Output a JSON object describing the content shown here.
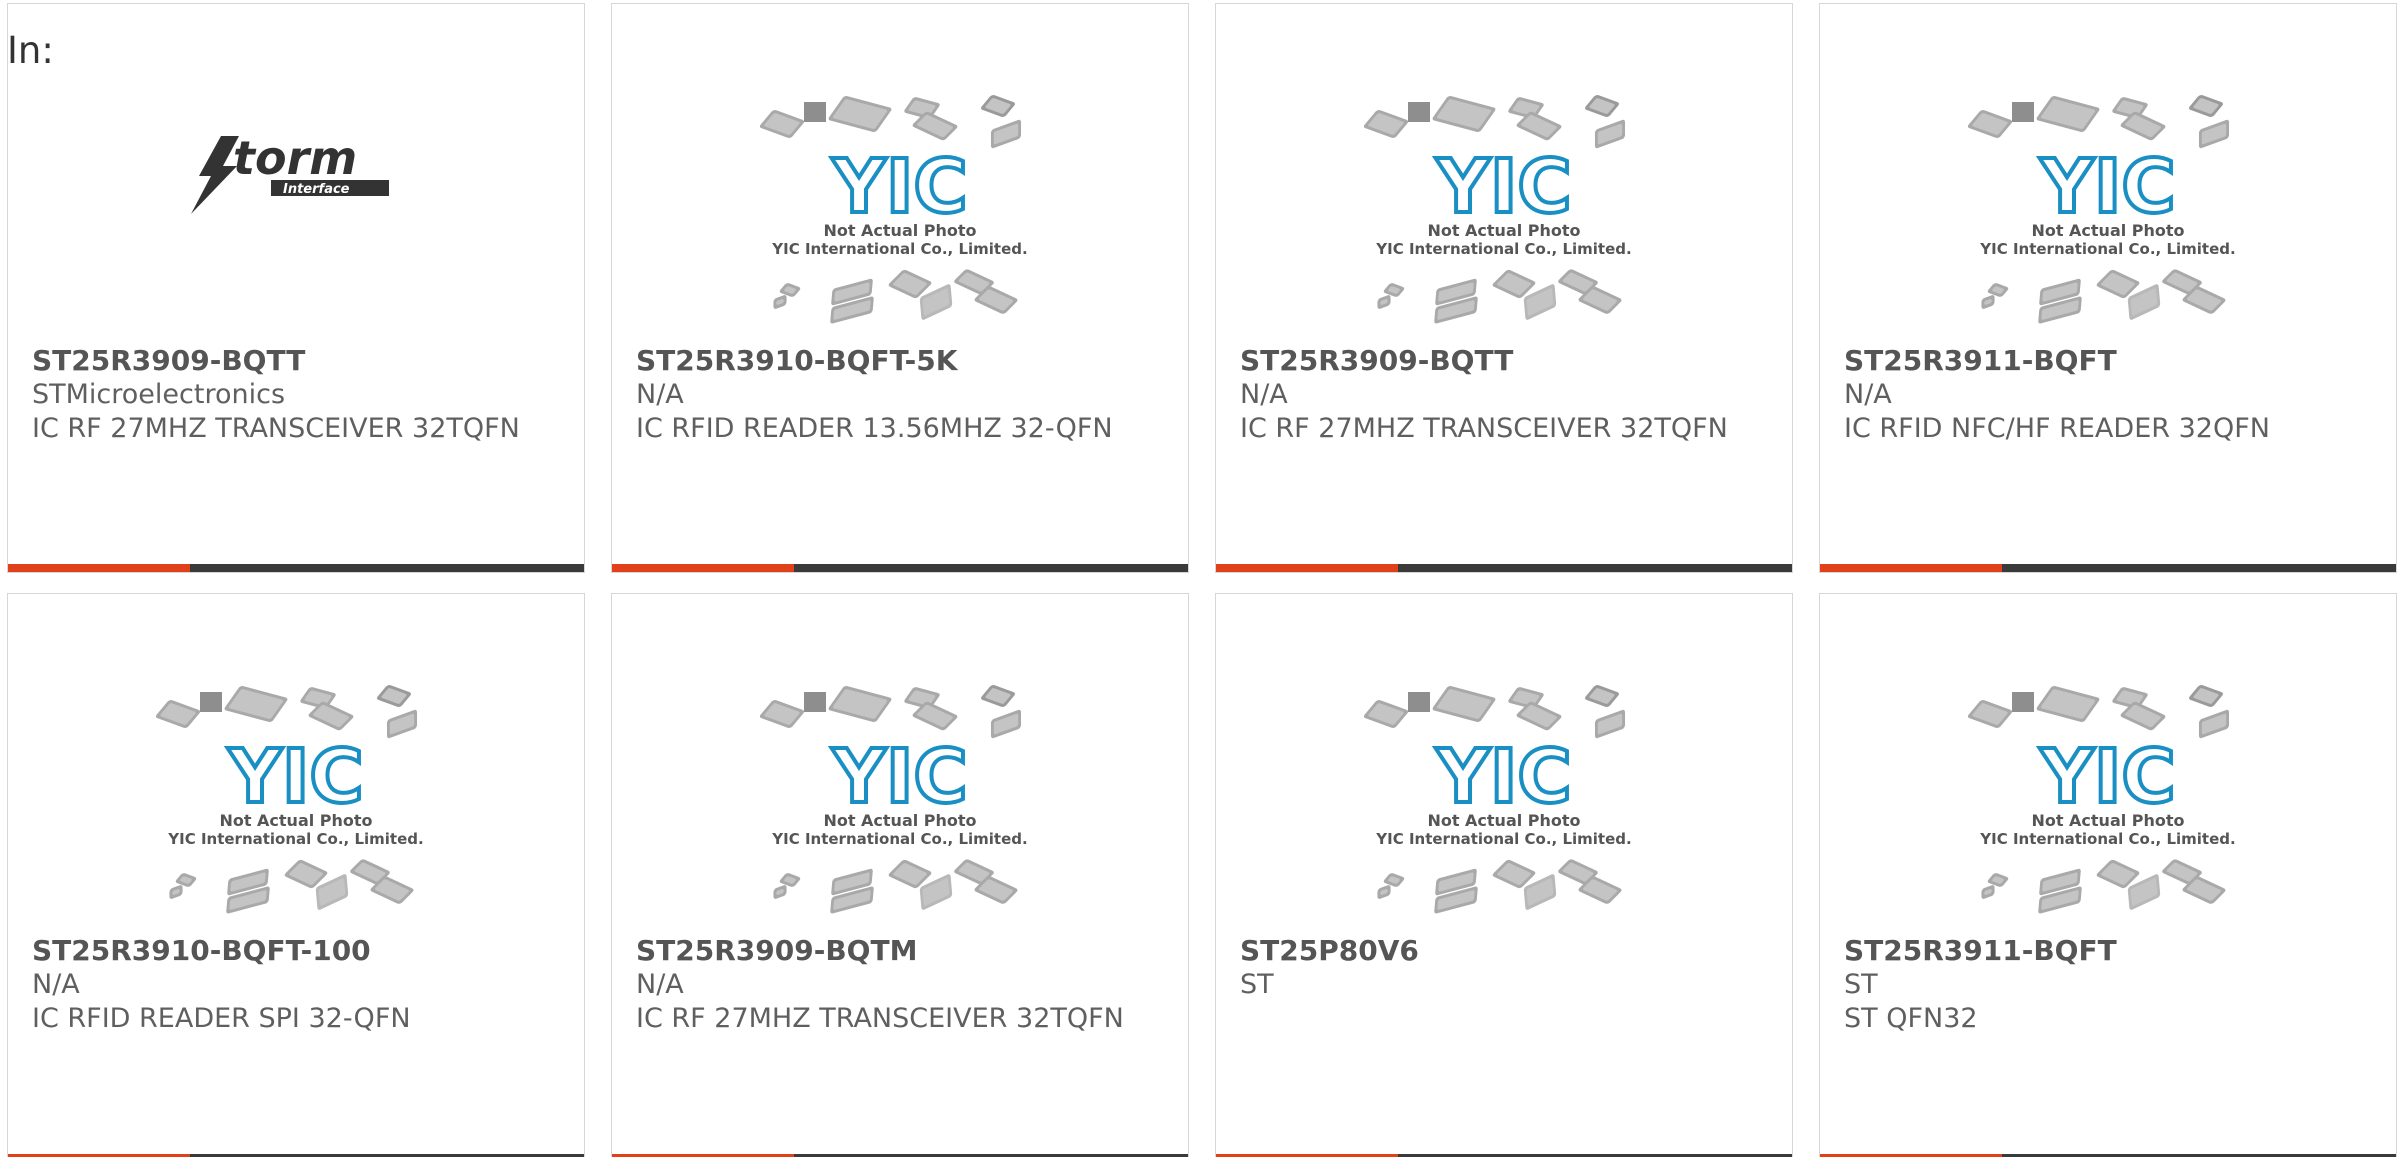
{
  "header": {
    "in_label": "In:"
  },
  "colors": {
    "accent": "#e0401a",
    "bar": "#3a3a3a",
    "yic_blue": "#1a8fc4",
    "chip_gray": "#a9a9a9"
  },
  "placeholder": {
    "brand": "YIC",
    "line1": "Not Actual Photo",
    "line2": "YIC International Co., Limited."
  },
  "storm_logo": {
    "word": "torm",
    "sub": "Interface"
  },
  "products": [
    {
      "part": "ST25R3909-BQTT",
      "maker": "STMicroelectronics",
      "desc": "IC RF 27MHZ TRANSCEIVER 32TQFN",
      "image": "storm-logo"
    },
    {
      "part": "ST25R3910-BQFT-5K",
      "maker": "N/A",
      "desc": "IC RFID READER 13.56MHZ 32-QFN",
      "image": "yic-placeholder"
    },
    {
      "part": "ST25R3909-BQTT",
      "maker": "N/A",
      "desc": "IC RF 27MHZ TRANSCEIVER 32TQFN",
      "image": "yic-placeholder"
    },
    {
      "part": "ST25R3911-BQFT",
      "maker": "N/A",
      "desc": "IC RFID NFC/HF READER 32QFN",
      "image": "yic-placeholder"
    },
    {
      "part": "ST25R3910-BQFT-100",
      "maker": "N/A",
      "desc": "IC RFID READER SPI 32-QFN",
      "image": "yic-placeholder"
    },
    {
      "part": "ST25R3909-BQTM",
      "maker": "N/A",
      "desc": "IC RF 27MHZ TRANSCEIVER 32TQFN",
      "image": "yic-placeholder"
    },
    {
      "part": "ST25P80V6",
      "maker": "ST",
      "desc": "",
      "image": "yic-placeholder"
    },
    {
      "part": "ST25R3911-BQFT",
      "maker": "ST",
      "desc": "ST QFN32",
      "image": "yic-placeholder"
    }
  ]
}
